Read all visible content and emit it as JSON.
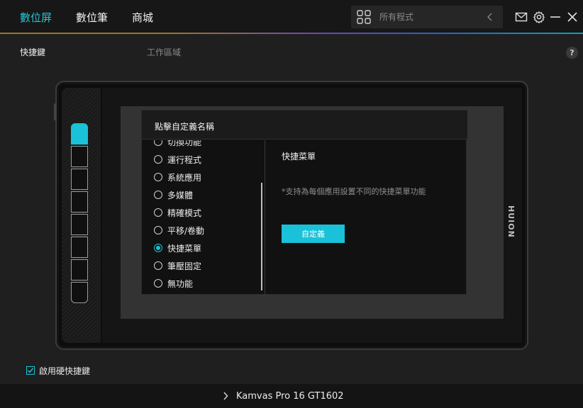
{
  "nav": {
    "tabs": [
      {
        "label": "數位屏",
        "active": true
      },
      {
        "label": "數位筆",
        "active": false
      },
      {
        "label": "商城",
        "active": false
      }
    ],
    "search_placeholder": "所有程式",
    "accent_color": "#19c2d8"
  },
  "subheader": {
    "left_label": "快捷鍵",
    "center_label": "工作區域",
    "help": "?"
  },
  "device": {
    "brand": "HUION",
    "express_keys": 8,
    "selected_key_index": 0
  },
  "popup": {
    "title": "點擊自定義名稱",
    "options": [
      {
        "label": "切換功能",
        "checked": false
      },
      {
        "label": "運行程式",
        "checked": false
      },
      {
        "label": "系統應用",
        "checked": false
      },
      {
        "label": "多媒體",
        "checked": false
      },
      {
        "label": "精確模式",
        "checked": false
      },
      {
        "label": "平移/卷動",
        "checked": false
      },
      {
        "label": "快捷菜單",
        "checked": true
      },
      {
        "label": "筆壓固定",
        "checked": false
      },
      {
        "label": "無功能",
        "checked": false
      }
    ],
    "detail_title": "快捷菜單",
    "detail_description": "*支持為每個應用設置不同的快捷菜單功能",
    "custom_button": "自定義"
  },
  "footer": {
    "enable_express_keys_label": "啟用硬快捷鍵",
    "enable_express_keys_checked": true,
    "device_name": "Kamvas Pro 16 GT1602"
  }
}
